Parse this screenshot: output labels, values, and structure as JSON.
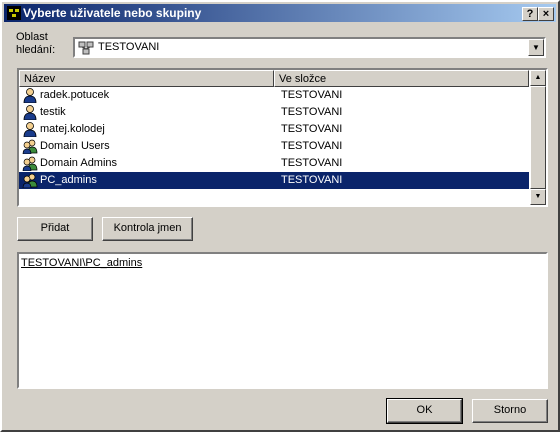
{
  "window": {
    "title": "Vyberte uživatele nebo skupiny"
  },
  "titlebar": {
    "help_label": "?",
    "close_label": "×"
  },
  "location": {
    "label": "Oblast\nhledání:",
    "value": "TESTOVANI",
    "icon": "domain-icon"
  },
  "list": {
    "columns": [
      "Název",
      "Ve složce"
    ],
    "rows": [
      {
        "name": "radek.potucek",
        "folder": "TESTOVANI",
        "icon": "user-icon",
        "selected": false
      },
      {
        "name": "testik",
        "folder": "TESTOVANI",
        "icon": "user-icon",
        "selected": false
      },
      {
        "name": "matej.kolodej",
        "folder": "TESTOVANI",
        "icon": "user-icon",
        "selected": false
      },
      {
        "name": "Domain Users",
        "folder": "TESTOVANI",
        "icon": "group-icon",
        "selected": false
      },
      {
        "name": "Domain Admins",
        "folder": "TESTOVANI",
        "icon": "group-icon",
        "selected": false
      },
      {
        "name": "PC_admins",
        "folder": "TESTOVANI",
        "icon": "group-icon",
        "selected": true
      }
    ]
  },
  "buttons": {
    "add": "Přidat",
    "check": "Kontrola jmen",
    "ok": "OK",
    "cancel": "Storno"
  },
  "selected_names": {
    "entry": "TESTOVANI\\PC_admins"
  },
  "colors": {
    "titlebar": "#0a246a",
    "selection": "#0a246a",
    "face": "#d4d0c8"
  }
}
